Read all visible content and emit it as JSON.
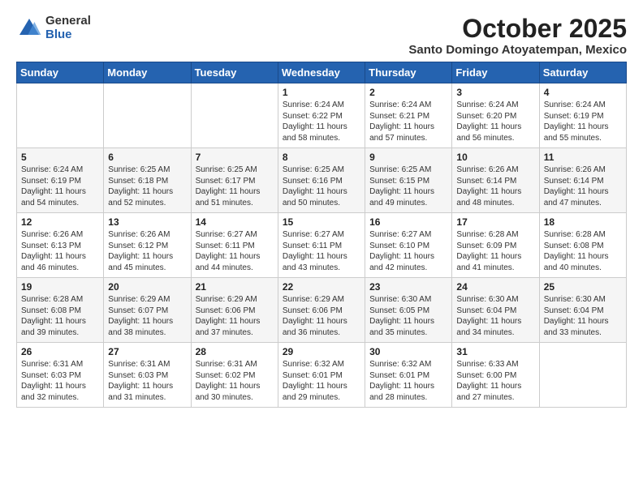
{
  "logo": {
    "general": "General",
    "blue": "Blue"
  },
  "title": "October 2025",
  "subtitle": "Santo Domingo Atoyatempan, Mexico",
  "weekdays": [
    "Sunday",
    "Monday",
    "Tuesday",
    "Wednesday",
    "Thursday",
    "Friday",
    "Saturday"
  ],
  "weeks": [
    [
      {
        "day": "",
        "info": ""
      },
      {
        "day": "",
        "info": ""
      },
      {
        "day": "",
        "info": ""
      },
      {
        "day": "1",
        "info": "Sunrise: 6:24 AM\nSunset: 6:22 PM\nDaylight: 11 hours\nand 58 minutes."
      },
      {
        "day": "2",
        "info": "Sunrise: 6:24 AM\nSunset: 6:21 PM\nDaylight: 11 hours\nand 57 minutes."
      },
      {
        "day": "3",
        "info": "Sunrise: 6:24 AM\nSunset: 6:20 PM\nDaylight: 11 hours\nand 56 minutes."
      },
      {
        "day": "4",
        "info": "Sunrise: 6:24 AM\nSunset: 6:19 PM\nDaylight: 11 hours\nand 55 minutes."
      }
    ],
    [
      {
        "day": "5",
        "info": "Sunrise: 6:24 AM\nSunset: 6:19 PM\nDaylight: 11 hours\nand 54 minutes."
      },
      {
        "day": "6",
        "info": "Sunrise: 6:25 AM\nSunset: 6:18 PM\nDaylight: 11 hours\nand 52 minutes."
      },
      {
        "day": "7",
        "info": "Sunrise: 6:25 AM\nSunset: 6:17 PM\nDaylight: 11 hours\nand 51 minutes."
      },
      {
        "day": "8",
        "info": "Sunrise: 6:25 AM\nSunset: 6:16 PM\nDaylight: 11 hours\nand 50 minutes."
      },
      {
        "day": "9",
        "info": "Sunrise: 6:25 AM\nSunset: 6:15 PM\nDaylight: 11 hours\nand 49 minutes."
      },
      {
        "day": "10",
        "info": "Sunrise: 6:26 AM\nSunset: 6:14 PM\nDaylight: 11 hours\nand 48 minutes."
      },
      {
        "day": "11",
        "info": "Sunrise: 6:26 AM\nSunset: 6:14 PM\nDaylight: 11 hours\nand 47 minutes."
      }
    ],
    [
      {
        "day": "12",
        "info": "Sunrise: 6:26 AM\nSunset: 6:13 PM\nDaylight: 11 hours\nand 46 minutes."
      },
      {
        "day": "13",
        "info": "Sunrise: 6:26 AM\nSunset: 6:12 PM\nDaylight: 11 hours\nand 45 minutes."
      },
      {
        "day": "14",
        "info": "Sunrise: 6:27 AM\nSunset: 6:11 PM\nDaylight: 11 hours\nand 44 minutes."
      },
      {
        "day": "15",
        "info": "Sunrise: 6:27 AM\nSunset: 6:11 PM\nDaylight: 11 hours\nand 43 minutes."
      },
      {
        "day": "16",
        "info": "Sunrise: 6:27 AM\nSunset: 6:10 PM\nDaylight: 11 hours\nand 42 minutes."
      },
      {
        "day": "17",
        "info": "Sunrise: 6:28 AM\nSunset: 6:09 PM\nDaylight: 11 hours\nand 41 minutes."
      },
      {
        "day": "18",
        "info": "Sunrise: 6:28 AM\nSunset: 6:08 PM\nDaylight: 11 hours\nand 40 minutes."
      }
    ],
    [
      {
        "day": "19",
        "info": "Sunrise: 6:28 AM\nSunset: 6:08 PM\nDaylight: 11 hours\nand 39 minutes."
      },
      {
        "day": "20",
        "info": "Sunrise: 6:29 AM\nSunset: 6:07 PM\nDaylight: 11 hours\nand 38 minutes."
      },
      {
        "day": "21",
        "info": "Sunrise: 6:29 AM\nSunset: 6:06 PM\nDaylight: 11 hours\nand 37 minutes."
      },
      {
        "day": "22",
        "info": "Sunrise: 6:29 AM\nSunset: 6:06 PM\nDaylight: 11 hours\nand 36 minutes."
      },
      {
        "day": "23",
        "info": "Sunrise: 6:30 AM\nSunset: 6:05 PM\nDaylight: 11 hours\nand 35 minutes."
      },
      {
        "day": "24",
        "info": "Sunrise: 6:30 AM\nSunset: 6:04 PM\nDaylight: 11 hours\nand 34 minutes."
      },
      {
        "day": "25",
        "info": "Sunrise: 6:30 AM\nSunset: 6:04 PM\nDaylight: 11 hours\nand 33 minutes."
      }
    ],
    [
      {
        "day": "26",
        "info": "Sunrise: 6:31 AM\nSunset: 6:03 PM\nDaylight: 11 hours\nand 32 minutes."
      },
      {
        "day": "27",
        "info": "Sunrise: 6:31 AM\nSunset: 6:03 PM\nDaylight: 11 hours\nand 31 minutes."
      },
      {
        "day": "28",
        "info": "Sunrise: 6:31 AM\nSunset: 6:02 PM\nDaylight: 11 hours\nand 30 minutes."
      },
      {
        "day": "29",
        "info": "Sunrise: 6:32 AM\nSunset: 6:01 PM\nDaylight: 11 hours\nand 29 minutes."
      },
      {
        "day": "30",
        "info": "Sunrise: 6:32 AM\nSunset: 6:01 PM\nDaylight: 11 hours\nand 28 minutes."
      },
      {
        "day": "31",
        "info": "Sunrise: 6:33 AM\nSunset: 6:00 PM\nDaylight: 11 hours\nand 27 minutes."
      },
      {
        "day": "",
        "info": ""
      }
    ]
  ]
}
